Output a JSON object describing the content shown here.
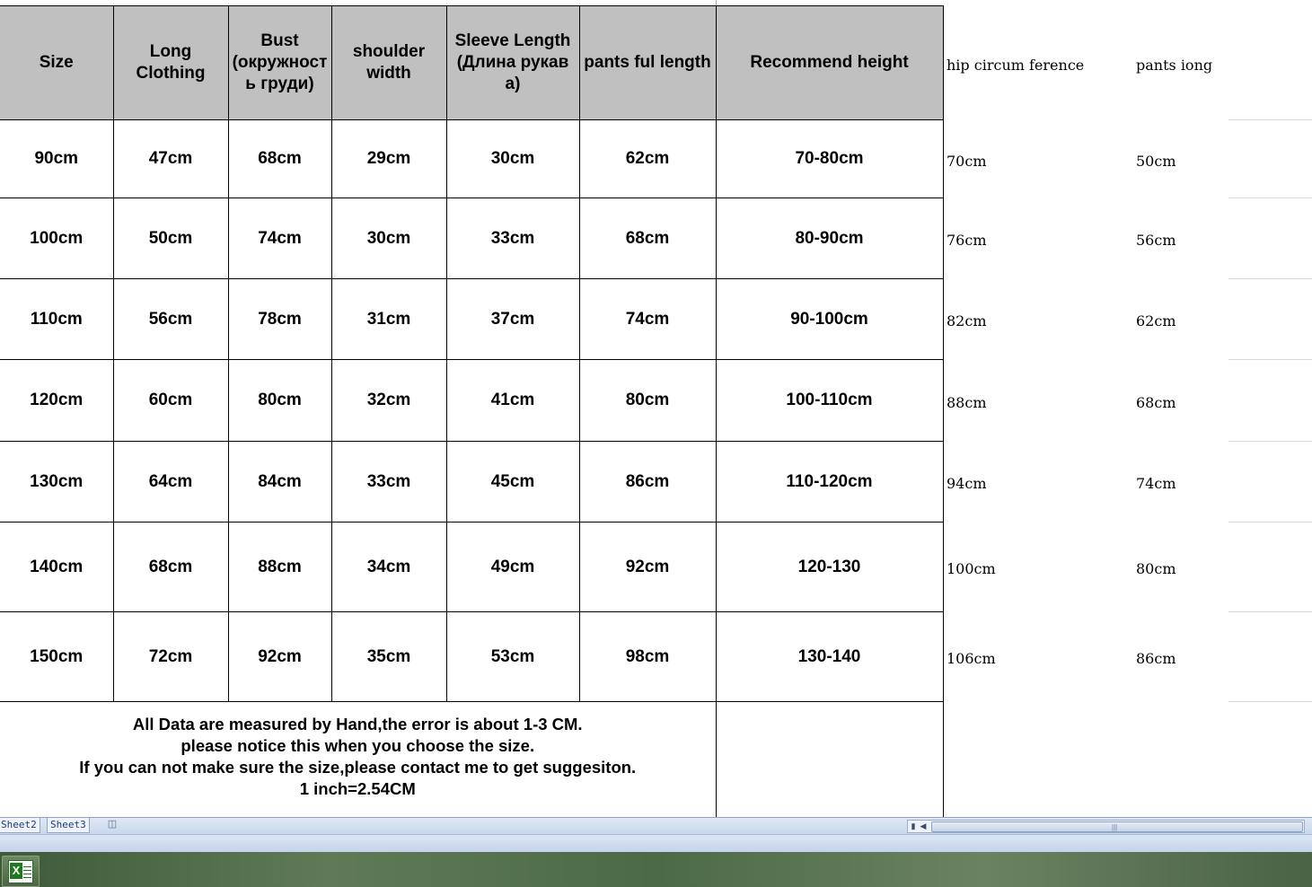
{
  "table": {
    "headers": [
      [
        "Size"
      ],
      [
        "Long",
        "Clothing"
      ],
      [
        "Bust",
        "(окружност",
        "ь груди)"
      ],
      [
        "shoulder",
        "width"
      ],
      [
        "Sleeve Length",
        "(Длина рукав",
        "а)"
      ],
      [
        "pants ful length"
      ],
      [
        "Recommend height"
      ]
    ],
    "rows": [
      [
        "90cm",
        "47cm",
        "68cm",
        "29cm",
        "30cm",
        "62cm",
        "70-80cm"
      ],
      [
        "100cm",
        "50cm",
        "74cm",
        "30cm",
        "33cm",
        "68cm",
        "80-90cm"
      ],
      [
        "110cm",
        "56cm",
        "78cm",
        "31cm",
        "37cm",
        "74cm",
        "90-100cm"
      ],
      [
        "120cm",
        "60cm",
        "80cm",
        "32cm",
        "41cm",
        "80cm",
        "100-110cm"
      ],
      [
        "130cm",
        "64cm",
        "84cm",
        "33cm",
        "45cm",
        "86cm",
        "110-120cm"
      ],
      [
        "140cm",
        "68cm",
        "88cm",
        "34cm",
        "49cm",
        "92cm",
        "120-130"
      ],
      [
        "150cm",
        "72cm",
        "92cm",
        "35cm",
        "53cm",
        "98cm",
        "130-140"
      ]
    ],
    "note": [
      "All Data are measured by Hand,the error is about 1-3 CM.",
      "please notice this when you choose the size.",
      "If you can not make sure the size,please contact me to get suggesiton.",
      "1 inch=2.54CM"
    ]
  },
  "extra": {
    "headers": [
      "hip circum ference",
      "pants iong"
    ],
    "rows": [
      [
        "70cm",
        "50cm"
      ],
      [
        "76cm",
        "56cm"
      ],
      [
        "82cm",
        "62cm"
      ],
      [
        "88cm",
        "68cm"
      ],
      [
        "94cm",
        "74cm"
      ],
      [
        "100cm",
        "80cm"
      ],
      [
        "106cm",
        "86cm"
      ]
    ]
  },
  "sheet_tabs": [
    "Sheet2",
    "Sheet3"
  ],
  "icons": {
    "insert_sheet": "insert-sheet-icon",
    "excel": "excel-icon"
  }
}
